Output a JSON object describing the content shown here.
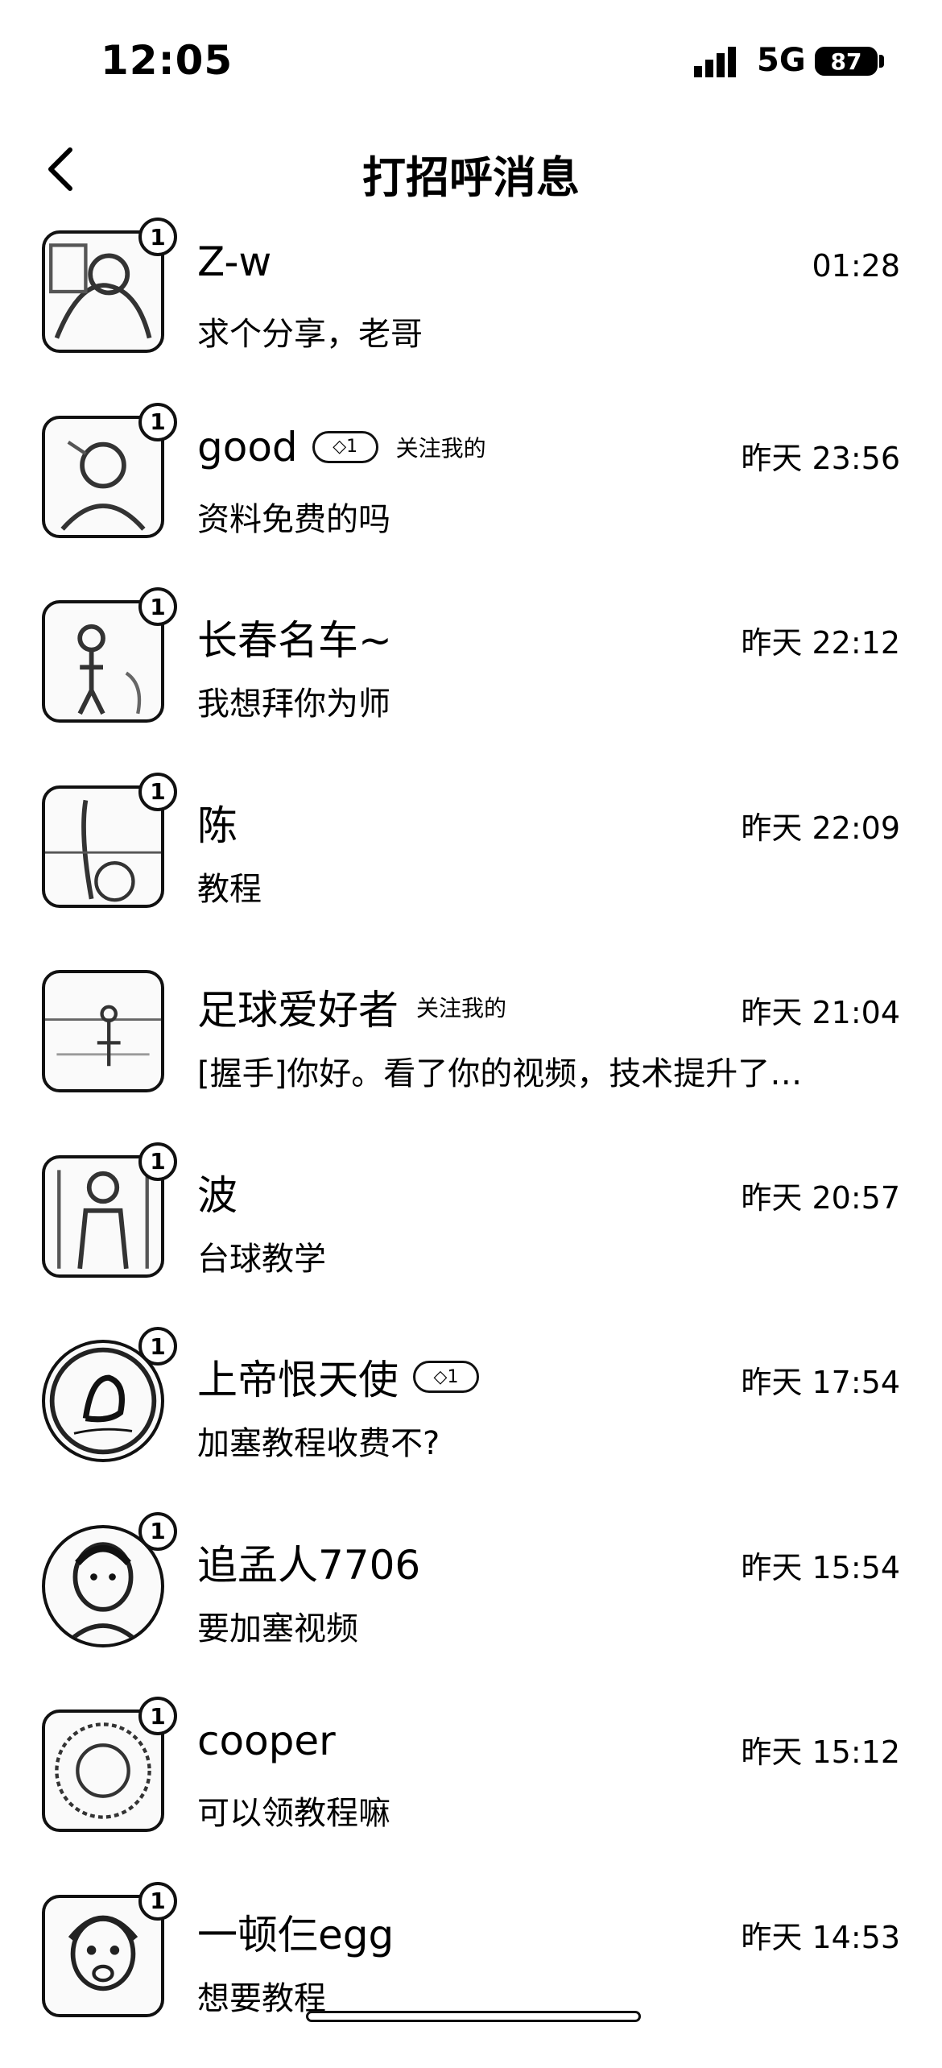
{
  "status_bar": {
    "time": "12:05",
    "network": "5G",
    "battery": "87"
  },
  "header": {
    "title": "打招呼消息"
  },
  "conversations": [
    {
      "name": "Z-w",
      "time": "01:28",
      "message": "求个分享，老哥",
      "unread": "1",
      "tag": ""
    },
    {
      "name": "good",
      "time": "昨天 23:56",
      "message": "资料免费的吗",
      "unread": "1",
      "tag": "关注我的",
      "pill": "◇1"
    },
    {
      "name": "长春名车~",
      "time": "昨天 22:12",
      "message": "我想拜你为师",
      "unread": "1",
      "tag": ""
    },
    {
      "name": "陈",
      "time": "昨天 22:09",
      "message": "教程",
      "unread": "1",
      "tag": ""
    },
    {
      "name": "足球爱好者",
      "time": "昨天 21:04",
      "message": "[握手]你好。看了你的视频，技术提升了…",
      "unread": "",
      "tag": "关注我的"
    },
    {
      "name": "波",
      "time": "昨天 20:57",
      "message": "台球教学",
      "unread": "1",
      "tag": ""
    },
    {
      "name": "上帝恨天使",
      "time": "昨天 17:54",
      "message": "加塞教程收费不?",
      "unread": "1",
      "tag": "",
      "pill": "◇1"
    },
    {
      "name": "追孟人7706",
      "time": "昨天 15:54",
      "message": "要加塞视频",
      "unread": "1",
      "tag": ""
    },
    {
      "name": "cooper",
      "time": "昨天 15:12",
      "message": "可以领教程嘛",
      "unread": "1",
      "tag": ""
    },
    {
      "name": "一顿仨egg",
      "time": "昨天 14:53",
      "message": "想要教程",
      "unread": "1",
      "tag": ""
    }
  ],
  "icons": {
    "back": "chevron-left-icon",
    "signal": "signal-icon",
    "battery": "battery-icon"
  }
}
